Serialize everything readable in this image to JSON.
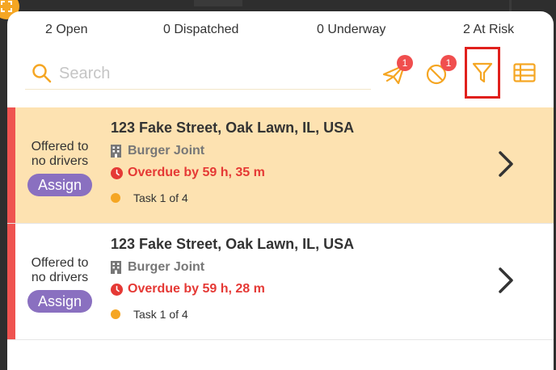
{
  "stats": {
    "open": "2 Open",
    "dispatched": "0 Dispatched",
    "underway": "0 Underway",
    "at_risk": "2 At Risk"
  },
  "search": {
    "placeholder": "Search",
    "value": ""
  },
  "toolbar": {
    "dispatch_badge": "1",
    "unassigned_badge": "1",
    "accent_color": "#f5a623",
    "icons": [
      "paper-plane-icon",
      "no-driver-icon",
      "filter-icon",
      "table-view-icon"
    ]
  },
  "tasks": [
    {
      "offer_line1": "Offered to",
      "offer_line2": "no drivers",
      "assign_label": "Assign",
      "address": "123 Fake Street, Oak Lawn, IL, USA",
      "merchant": "Burger Joint",
      "overdue": "Overdue by 59 h, 35 m",
      "task_progress": "Task 1 of 4",
      "highlighted": true
    },
    {
      "offer_line1": "Offered to",
      "offer_line2": "no drivers",
      "assign_label": "Assign",
      "address": "123 Fake Street, Oak Lawn, IL, USA",
      "merchant": "Burger Joint",
      "overdue": "Overdue by 59 h, 28 m",
      "task_progress": "Task 1 of 4",
      "highlighted": false
    }
  ]
}
